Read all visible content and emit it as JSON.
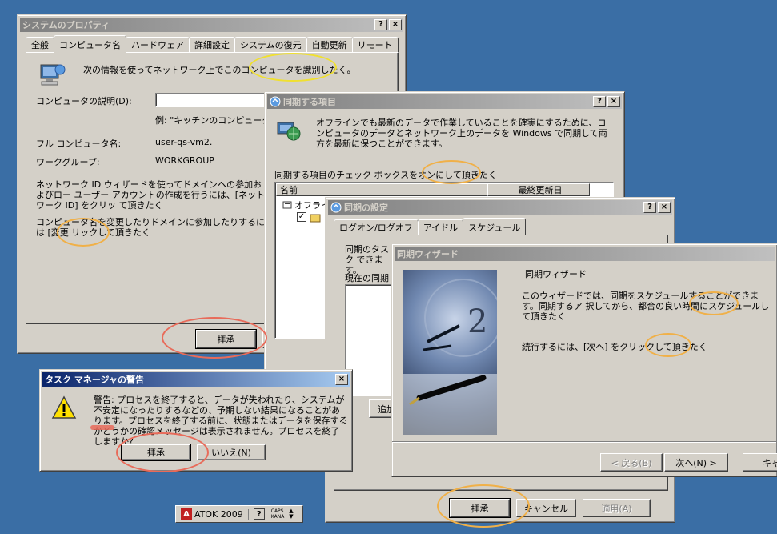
{
  "sysprops": {
    "title": "システムのプロパティ",
    "tabs": [
      "全般",
      "コンピュータ名",
      "ハードウェア",
      "詳細設定",
      "システムの復元",
      "自動更新",
      "リモート"
    ],
    "intro": "次の情報を使ってネットワーク上でこのコンピュータを識別したく。",
    "desc_label": "コンピュータの説明(D):",
    "desc_value": "",
    "example": "例: \"キッチンのコンピュータ\"、",
    "fullname_label": "フル コンピュータ名:",
    "fullname_value": "user-qs-vm2.",
    "workgroup_label": "ワークグループ:",
    "workgroup_value": "WORKGROUP",
    "netid_text": "ネットワーク ID ウィザードを使ってドメインへの参加およびロー ユーザー アカウントの作成を行うには、[ネットワーク ID] をクリッ て頂きたく",
    "rename_text": "コンピュータ名を変更したりドメインに参加したりするには [変更 リックして頂きたく",
    "ok_label": "拝承"
  },
  "syncitems": {
    "title": "同期する項目",
    "intro": "オフラインでも最新のデータで作業していることを確実にするために、コンピュータのデータとネットワーク上のデータを Windows で同期して両方を最新に保つことができます。",
    "check_text": "同期する項目のチェック ボックスをオンにして頂きたく",
    "col_name": "名前",
    "col_updated": "最終更新日",
    "row1": "オフライ",
    "help_btn": "?",
    "close_btn": "×"
  },
  "syncsettings": {
    "title": "同期の設定",
    "tabs": [
      "ログオン/ログオフ",
      "アイドル",
      "スケジュール"
    ],
    "text1": "同期のタスク できます。",
    "text2": "現在の同期",
    "add_label": "追加",
    "ok_label": "拝承",
    "cancel_label": "キャンセル",
    "apply_label": "適用(A)"
  },
  "wizard": {
    "title": "同期ウィザード",
    "heading": "同期ウィザード",
    "text1": "このウィザードでは、同期をスケジュールすることができます。同期するア 択してから、都合の良い時間にスケジュールして頂きたく",
    "text2": "続行するには、[次へ] をクリックして頂きたく",
    "back_label": "< 戻る(B)",
    "next_label": "次へ(N) >",
    "cancel_label": "キャ"
  },
  "taskmgr": {
    "title": "タスク マネージャの警告",
    "warning": "警告: プロセスを終了すると、データが失われたり、システムが不安定になったりするなどの、予期しない結果になることがあります。プロセスを終了する前に、状態またはデータを保存するかどうかの確認メッセージは表示されません。プロセスを終了しますか?",
    "yes_label": "拝承",
    "no_label": "いいえ(N)"
  },
  "tray": {
    "ime_name": "ATOK 2009",
    "caps": "CAPS",
    "kana": "KANA"
  }
}
